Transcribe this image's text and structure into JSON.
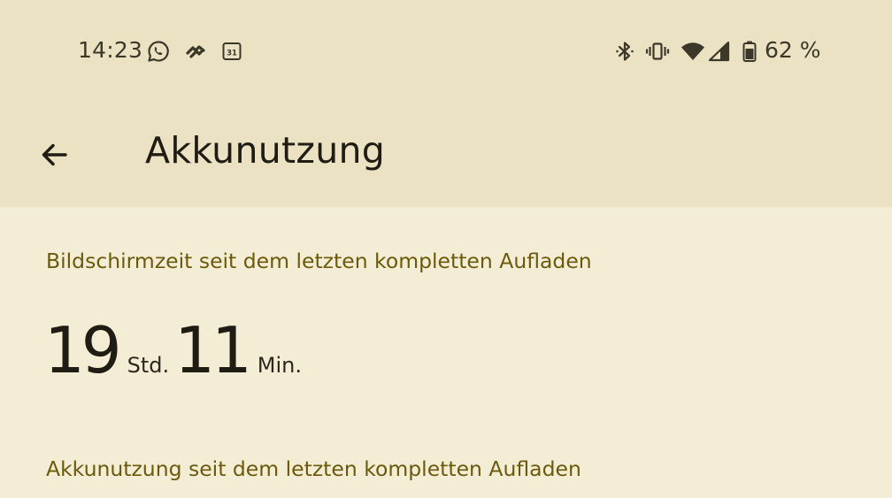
{
  "status_bar": {
    "time": "14:23",
    "left_icons": [
      "whatsapp-icon",
      "heart-app-icon",
      "calendar-icon"
    ],
    "calendar_day": "31",
    "right_icons": [
      "bluetooth-icon",
      "vibrate-icon",
      "wifi-icon",
      "cell-signal-icon",
      "battery-icon"
    ],
    "battery_level": 0.62,
    "battery_text": "62 %"
  },
  "app_bar": {
    "back_icon": "arrow-back-icon",
    "title": "Akkunutzung"
  },
  "screen_time": {
    "section_title": "Bildschirmzeit seit dem letzten kompletten Aufladen",
    "hours": "19",
    "hours_unit": "Std.",
    "minutes": "11",
    "minutes_unit": "Min."
  },
  "battery_usage": {
    "section_title": "Akkunutzung seit dem letzten kompletten Aufladen"
  },
  "colors": {
    "header_bg": "#ebe2c4",
    "content_bg": "#f4edd6",
    "accent_text": "#6b5a0a",
    "primary_text": "#1f1c14"
  }
}
